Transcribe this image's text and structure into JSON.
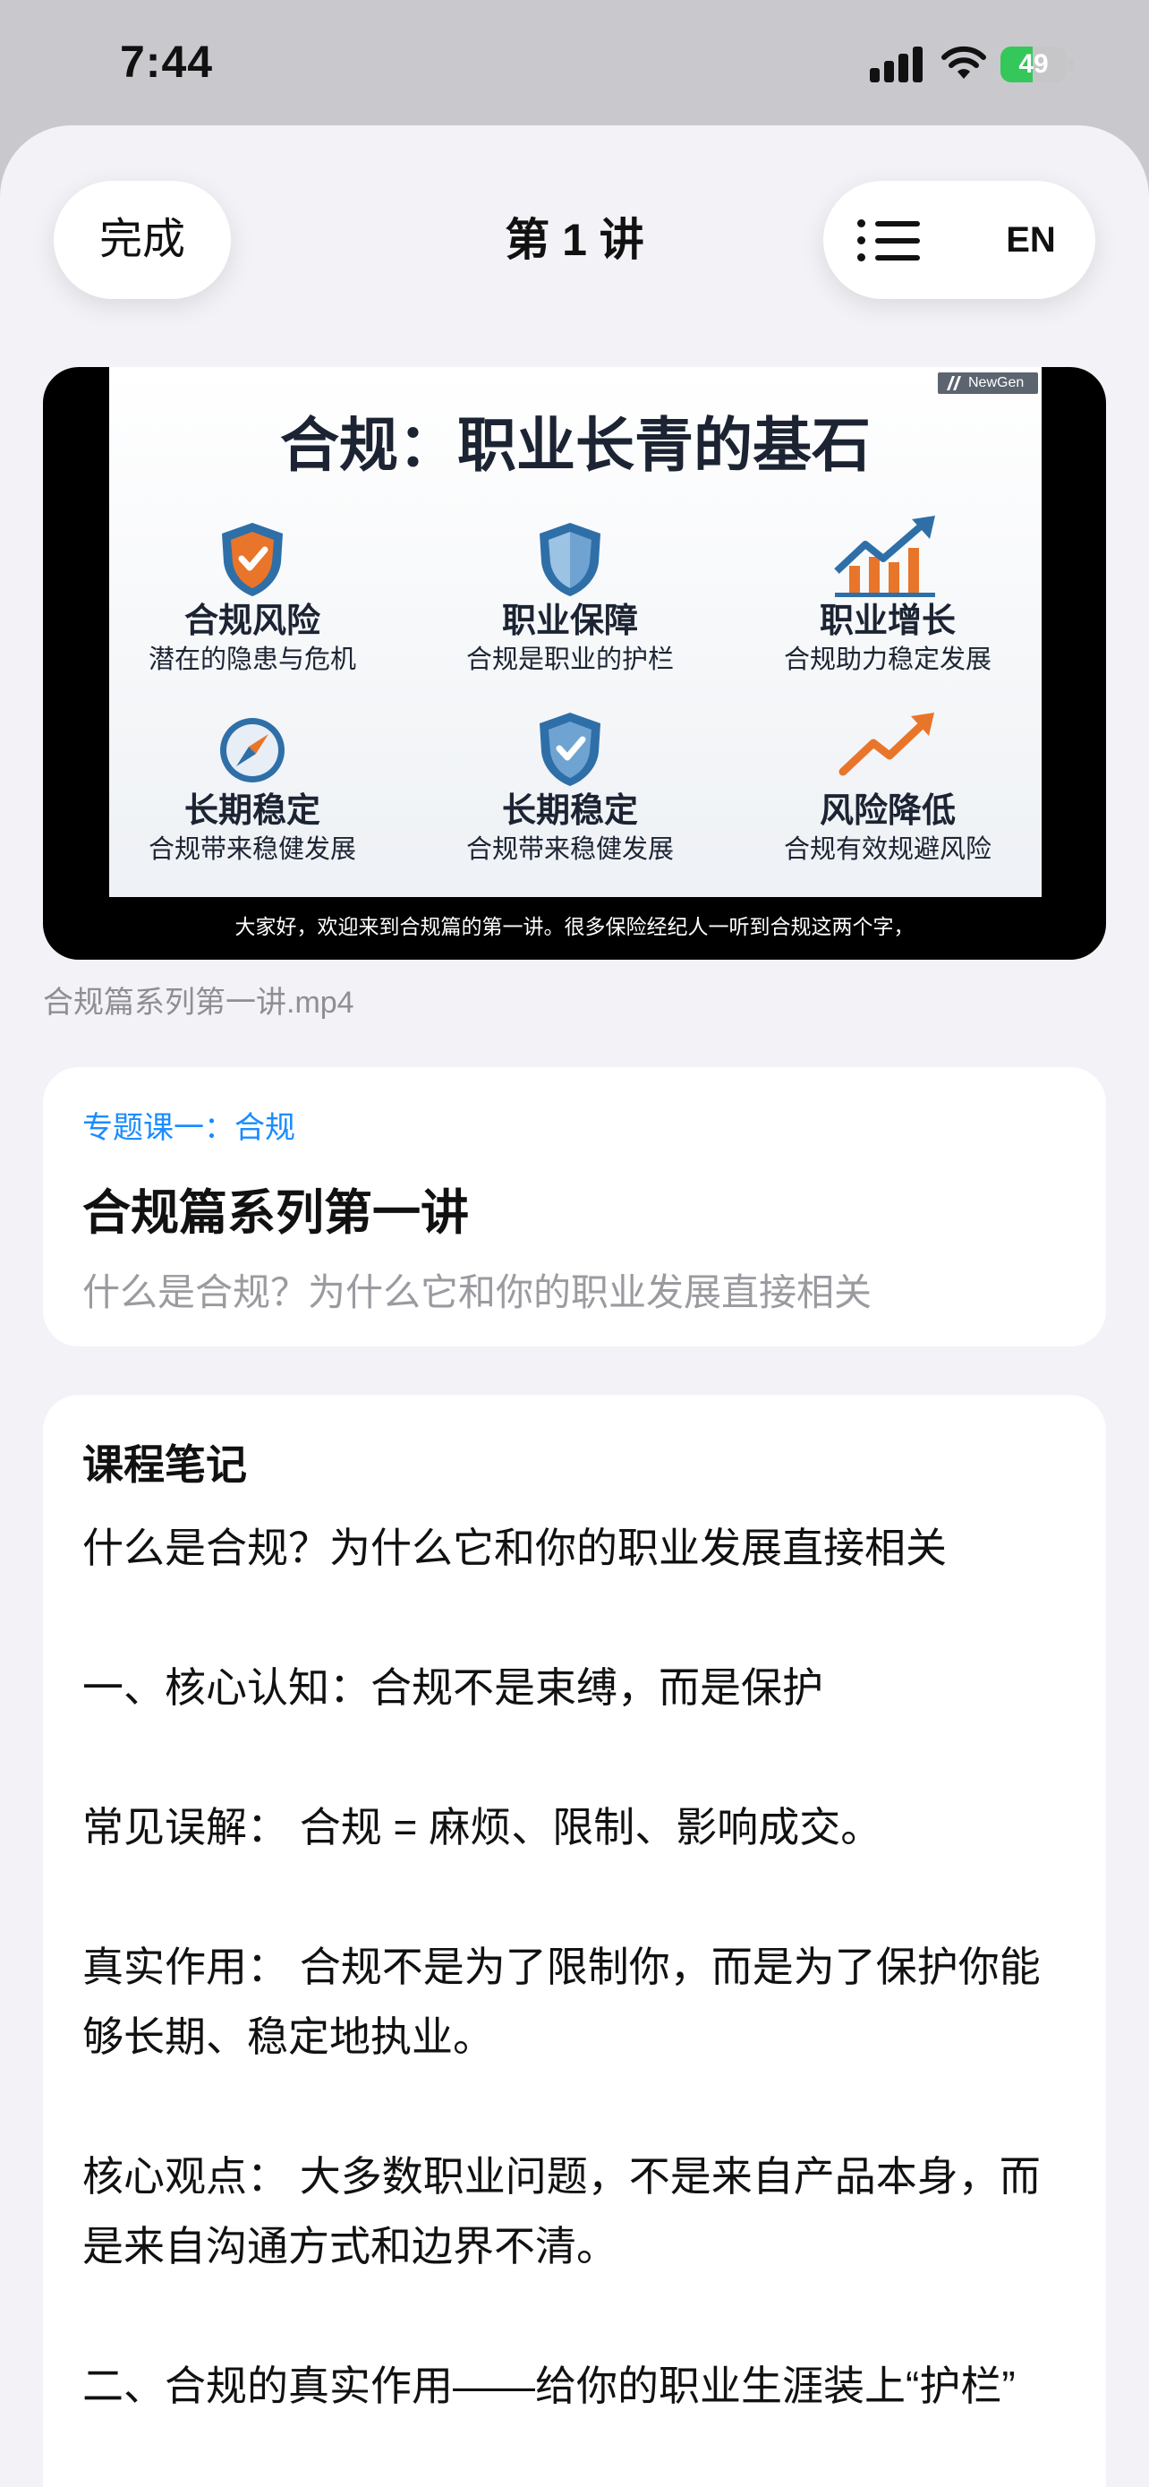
{
  "status_bar": {
    "time": "7:44",
    "battery_percent": "49",
    "battery_level": 0.49
  },
  "header": {
    "done_label": "完成",
    "title": "第 1 讲",
    "menu_icon": "list-icon",
    "language_label": "EN"
  },
  "video": {
    "brand_label": "NewGen",
    "slide_title": "合规：职业长青的基石",
    "features": [
      {
        "icon": "shield-check-icon",
        "name": "合规风险",
        "desc": "潜在的隐患与危机"
      },
      {
        "icon": "shield-icon",
        "name": "职业保障",
        "desc": "合规是职业的护栏"
      },
      {
        "icon": "growth-chart-icon",
        "name": "职业增长",
        "desc": "合规助力稳定发展"
      },
      {
        "icon": "compass-icon",
        "name": "长期稳定",
        "desc": "合规带来稳健发展"
      },
      {
        "icon": "shield-check-icon",
        "name": "长期稳定",
        "desc": "合规带来稳健发展"
      },
      {
        "icon": "trend-arrow-icon",
        "name": "风险降低",
        "desc": "合规有效规避风险"
      }
    ],
    "caption": "大家好，欢迎来到合规篇的第一讲。很多保险经纪人一听到合规这两个字，",
    "filename": "合规篇系列第一讲.mp4"
  },
  "course": {
    "topic": "专题课一：合规",
    "title": "合规篇系列第一讲",
    "subtitle": "什么是合规？为什么它和你的职业发展直接相关"
  },
  "notes": {
    "heading": "课程笔记",
    "paragraphs": [
      "什么是合规？为什么它和你的职业发展直接相关",
      "一、核心认知：合规不是束缚，而是保护",
      "常见误解： 合规 = 麻烦、限制、影响成交。",
      "真实作用： 合规不是为了限制你，而是为了保护你能够长期、稳定地执业。",
      "核心观点： 大多数职业问题，不是来自产品本身，而是来自沟通方式和边界不清。",
      "二、合规的真实作用——给你的职业生涯装上“护栏”"
    ]
  },
  "colors": {
    "accent": "#1a8cff",
    "battery_green": "#34c759",
    "icon_orange": "#e8752a",
    "icon_blue": "#2f6fa8"
  }
}
